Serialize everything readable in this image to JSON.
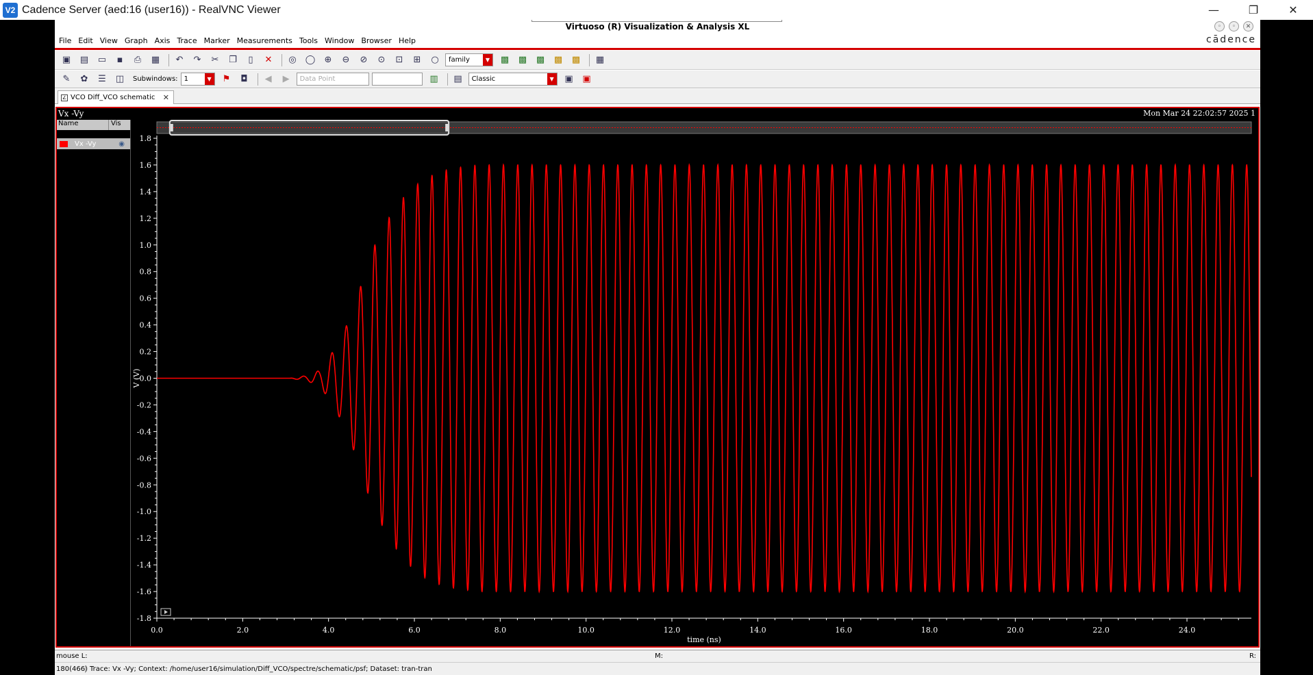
{
  "window": {
    "title": "Cadence Server (aed:16 (user16)) - RealVNC Viewer",
    "logo_text": "V2",
    "controls": [
      "—",
      "❐",
      "✕"
    ]
  },
  "app": {
    "title": "Virtuoso (R) Visualization & Analysis XL",
    "logo": "cādence",
    "menu": [
      "File",
      "Edit",
      "View",
      "Graph",
      "Axis",
      "Trace",
      "Marker",
      "Measurements",
      "Tools",
      "Window",
      "Browser",
      "Help"
    ]
  },
  "toolbar": {
    "family_value": "family",
    "subwindows_label": "Subwindows:",
    "subwindows_value": "1",
    "datapoint_placeholder": "Data Point",
    "style_value": "Classic"
  },
  "tab": {
    "label": "VCO Diff_VCO schematic"
  },
  "plot": {
    "title": "Vx -Vy",
    "date": "Mon Mar 24 22:02:57 2025  1",
    "legend_header_name": "Name",
    "legend_header_vis": "Vis",
    "legend_trace": "Vx -Vy"
  },
  "status": {
    "mouse": "mouse L:",
    "middle": "M:",
    "right": "R:",
    "count": "180(466)",
    "trace_info": "Trace: Vx -Vy; Context: /home/user16/simulation/Diff_VCO/spectre/schematic/psf; Dataset: tran-tran"
  },
  "colors": {
    "trace": "#ff0000",
    "accent": "#d40000",
    "background": "#000000"
  },
  "chart_data": {
    "type": "line",
    "xlabel": "time (ns)",
    "ylabel": "V (V)",
    "xlim": [
      0,
      25.5
    ],
    "ylim": [
      -1.8,
      1.8
    ],
    "xticks": [
      0.0,
      2.0,
      4.0,
      6.0,
      8.0,
      10.0,
      12.0,
      14.0,
      16.0,
      18.0,
      20.0,
      22.0,
      24.0
    ],
    "yticks": [
      1.8,
      1.6,
      1.4,
      1.2,
      1.0,
      0.8,
      0.6,
      0.4,
      0.2,
      0.0,
      -0.2,
      -0.4,
      -0.6,
      -0.8,
      -1.0,
      -1.2,
      -1.4,
      -1.6,
      -1.8
    ],
    "series": [
      {
        "name": "Vx -Vy",
        "signal": "sinusoid",
        "x": [
          0.0,
          3.1,
          3.5,
          3.8,
          4.1,
          4.4,
          4.7,
          5.0,
          5.4,
          5.8,
          6.2,
          6.6,
          7.0,
          7.5,
          25.5
        ],
        "envelope": [
          0.0,
          0.0,
          0.02,
          0.06,
          0.2,
          0.38,
          0.64,
          0.95,
          1.2,
          1.38,
          1.49,
          1.55,
          1.58,
          1.6,
          1.6
        ],
        "period_ns": 0.333
      }
    ],
    "grid": false,
    "legend": "left-panel"
  }
}
